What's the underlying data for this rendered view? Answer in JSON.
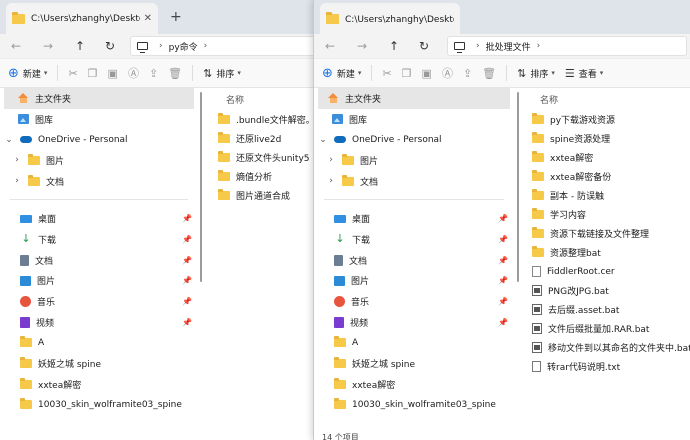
{
  "window1": {
    "tab_title": "C:\\Users\\zhanghy\\Desktop\\py",
    "path": [
      "py命令"
    ],
    "toolbar": {
      "new_label": "新建",
      "sort_label": "排序"
    },
    "quick_access": [
      {
        "label": "主文件夹",
        "icon": "home-icon",
        "selected": true
      },
      {
        "label": "图库",
        "icon": "gallery-icon"
      }
    ],
    "onedrive": {
      "label": "OneDrive - Personal",
      "children": [
        "图片",
        "文档"
      ]
    },
    "pinned": [
      {
        "label": "桌面",
        "icon": "desktop-icon"
      },
      {
        "label": "下载",
        "icon": "download-icon"
      },
      {
        "label": "文档",
        "icon": "doc-icon"
      },
      {
        "label": "图片",
        "icon": "pic-icon"
      },
      {
        "label": "音乐",
        "icon": "music-icon"
      },
      {
        "label": "视频",
        "icon": "video-icon"
      }
    ],
    "recent": [
      "A",
      "妖姬之城 spine",
      "xxtea解密",
      "10030_skin_wolframite03_spine"
    ],
    "column_name": "名称",
    "files": [
      ".bundle文件解密。去@",
      "还原live2d",
      "还原文件头unity5",
      "熵值分析",
      "图片通道合成"
    ]
  },
  "window2": {
    "tab_title": "C:\\Users\\zhanghy\\Desktop\\批",
    "path": [
      "批处理文件"
    ],
    "toolbar": {
      "new_label": "新建",
      "sort_label": "排序",
      "view_label": "查看"
    },
    "quick_access": [
      {
        "label": "主文件夹",
        "icon": "home-icon",
        "selected": true
      },
      {
        "label": "图库",
        "icon": "gallery-icon"
      }
    ],
    "onedrive": {
      "label": "OneDrive - Personal",
      "children": [
        "图片",
        "文档"
      ]
    },
    "pinned": [
      {
        "label": "桌面",
        "icon": "desktop-icon"
      },
      {
        "label": "下载",
        "icon": "download-icon"
      },
      {
        "label": "文档",
        "icon": "doc-icon"
      },
      {
        "label": "图片",
        "icon": "pic-icon"
      },
      {
        "label": "音乐",
        "icon": "music-icon"
      },
      {
        "label": "视频",
        "icon": "video-icon"
      }
    ],
    "recent": [
      "A",
      "妖姬之城 spine",
      "xxtea解密",
      "10030_skin_wolframite03_spine"
    ],
    "column_name": "名称",
    "files": [
      {
        "name": "py下载游戏资源",
        "type": "folder"
      },
      {
        "name": "spine资源处理",
        "type": "folder"
      },
      {
        "name": "xxtea解密",
        "type": "folder"
      },
      {
        "name": "xxtea解密备份",
        "type": "folder"
      },
      {
        "name": "副本 - 防误触",
        "type": "folder"
      },
      {
        "name": "学习内容",
        "type": "folder"
      },
      {
        "name": "资源下载链接及文件整理",
        "type": "folder"
      },
      {
        "name": "资源整理bat",
        "type": "folder"
      },
      {
        "name": "FiddlerRoot.cer",
        "type": "file"
      },
      {
        "name": "PNG改JPG.bat",
        "type": "bat"
      },
      {
        "name": "去后缀.asset.bat",
        "type": "bat"
      },
      {
        "name": "文件后缀批量加.RAR.bat",
        "type": "bat"
      },
      {
        "name": "移动文件到以其命名的文件夹中.bat",
        "type": "bat"
      },
      {
        "name": "转rar代码说明.txt",
        "type": "txt"
      }
    ],
    "status": "14 个项目"
  }
}
